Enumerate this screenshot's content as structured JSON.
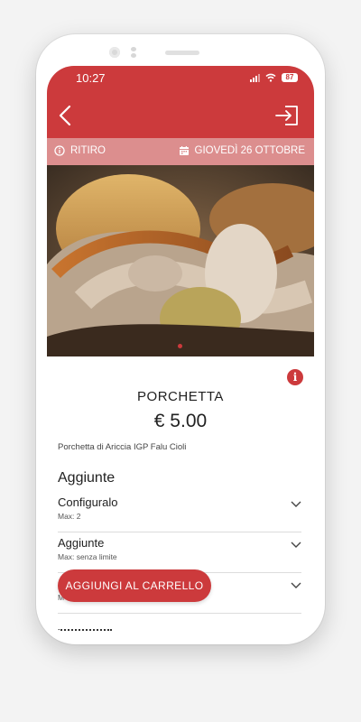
{
  "status_bar": {
    "time": "10:27",
    "battery": "87"
  },
  "info_bar": {
    "mode": "RITIRO",
    "date": "GIOVEDÌ 26 OTTOBRE"
  },
  "product": {
    "name": "PORCHETTA",
    "price": "€ 5.00",
    "description": "Porchetta di Ariccia IGP Falu Cioli"
  },
  "addons": {
    "section_title": "Aggiunte",
    "options": [
      {
        "name": "Configuralo",
        "sub": "Max: 2"
      },
      {
        "name": "Aggiunte",
        "sub": "Max: senza limite"
      },
      {
        "name": "",
        "sub": "M"
      }
    ]
  },
  "cart_button": "AGGIUNGI AL CARRELLO",
  "colors": {
    "accent": "#cc3a3c",
    "info_bar": "#dc8e8e"
  },
  "icons": [
    "back-arrow-icon",
    "login-icon",
    "info-circle-icon",
    "calendar-icon",
    "chevron-down-icon",
    "signal-icon",
    "wifi-icon",
    "battery-icon"
  ]
}
